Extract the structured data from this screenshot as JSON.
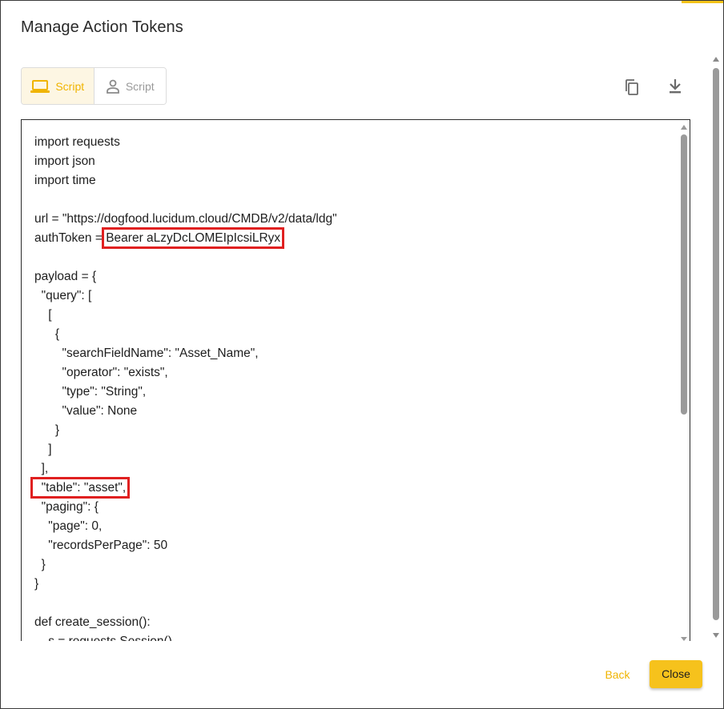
{
  "dialog": {
    "title": "Manage Action Tokens"
  },
  "toggle": {
    "items": [
      {
        "label": "Script",
        "icon": "laptop-icon",
        "active": true
      },
      {
        "label": "Script",
        "icon": "person-icon",
        "active": false
      }
    ]
  },
  "actions": {
    "copy_icon": "copy-icon",
    "download_icon": "download-icon"
  },
  "code": {
    "lines": [
      "import requests",
      "import json",
      "import time",
      "",
      "url = \"https://dogfood.lucidum.cloud/CMDB/v2/data/ldg\"",
      "authToken = ",
      "",
      "payload = {",
      "  \"query\": [",
      "    [",
      "      {",
      "        \"searchFieldName\": \"Asset_Name\",",
      "        \"operator\": \"exists\",",
      "        \"type\": \"String\",",
      "        \"value\": None",
      "      }",
      "    ]",
      "  ],",
      "  \"table\": \"asset\",",
      "  \"paging\": {",
      "    \"page\": 0,",
      "    \"recordsPerPage\": 50",
      "  }",
      "}",
      "",
      "def create_session():",
      "    s = requests.Session()"
    ],
    "auth_token_value": "Bearer aLzyDcLOMEIpIcsiLRyx"
  },
  "footer": {
    "back_label": "Back",
    "close_label": "Close"
  },
  "colors": {
    "accent": "#f6c21c",
    "accent_text": "#f0b400",
    "highlight": "#e02020"
  }
}
